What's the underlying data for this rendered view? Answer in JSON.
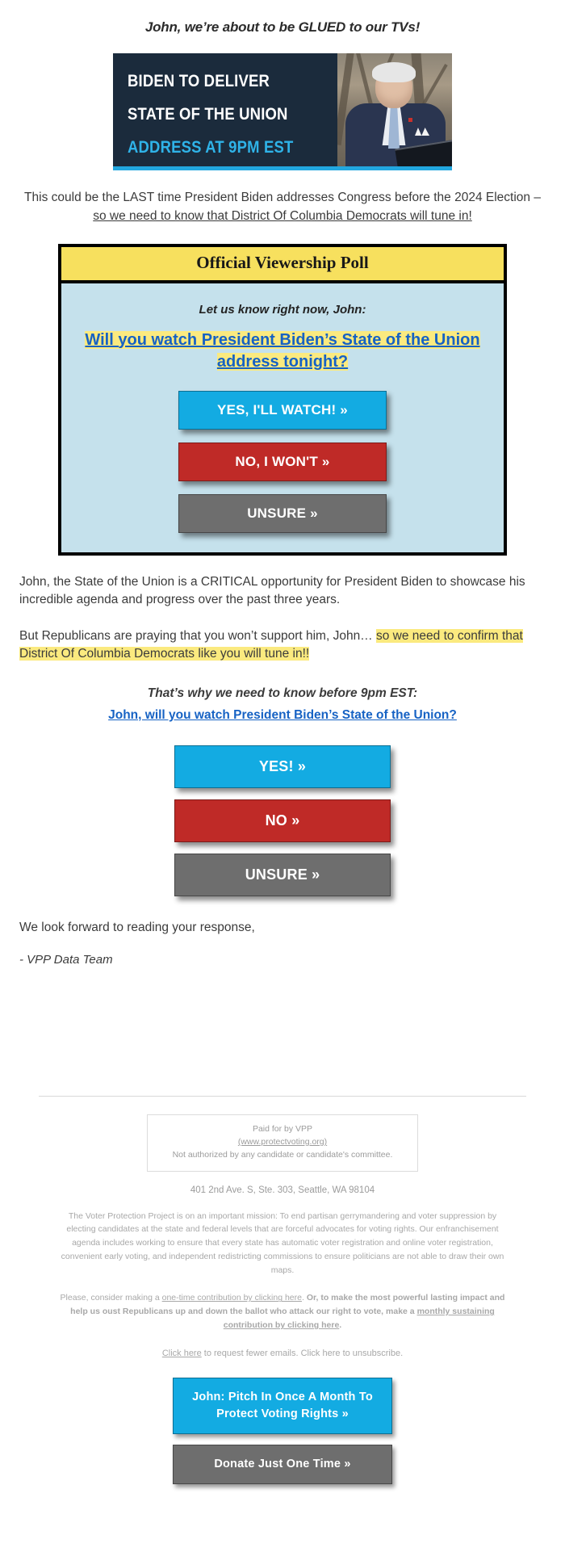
{
  "preheader": "John, we’re about to be GLUED to our TVs!",
  "hero": {
    "line1": "BIDEN TO DELIVER",
    "line2": "STATE OF THE UNION",
    "line3": "ADDRESS AT 9PM EST",
    "photo_alt": "president-biden-photo",
    "bg_color": "#1b2b3c",
    "accent_color": "#2fb3e8"
  },
  "intro": {
    "plain": "This could be the LAST time President Biden addresses Congress before the 2024 Election – ",
    "underlined": "so we need to know that District Of Columbia Democrats will tune in!"
  },
  "poll": {
    "header": "Official Viewership Poll",
    "kicker": "Let us know right now, John:",
    "question": "Will you watch President Biden’s State of the Union address tonight?",
    "header_bg": "#f7e05e",
    "body_bg": "#c5e1ec",
    "buttons": [
      {
        "label": "YES, I'LL WATCH! »",
        "color": "#13abe2",
        "style": "blue"
      },
      {
        "label": "NO, I WON'T »",
        "color": "#bf2a27",
        "style": "red"
      },
      {
        "label": "UNSURE »",
        "color": "#6e6e6e",
        "style": "grey"
      }
    ]
  },
  "body": {
    "p1": "John, the State of the Union is a CRITICAL opportunity for President Biden to showcase his incredible agenda and progress over the past three years.",
    "p2_plain": "But Republicans are praying that you won’t support him, John… ",
    "p2_highlight": "so we need to confirm that District Of Columbia Democrats like you will tune in!!",
    "cta_kicker": "That’s why we need to know before 9pm EST:",
    "cta_question": "John, will you watch President Biden’s State of the Union?",
    "closing": "We look forward to reading your response,",
    "signature": "- VPP Data Team"
  },
  "cta_buttons": [
    {
      "label": "YES! »",
      "color": "#13abe2",
      "style": "blue"
    },
    {
      "label": "NO »",
      "color": "#bf2a27",
      "style": "red"
    },
    {
      "label": "UNSURE »",
      "color": "#6e6e6e",
      "style": "grey"
    }
  ],
  "footer": {
    "paid_for": "Paid for by VPP",
    "website": "(www.protectvoting.org)",
    "not_authorized": "Not authorized by any candidate or candidate's committee.",
    "address": "401 2nd Ave. S, Ste. 303, Seattle, WA 98104",
    "mission": "The Voter Protection Project is on an important mission: To end partisan gerrymandering and voter suppression by electing candidates at the state and federal levels that are forceful advocates for voting rights. Our enfranchisement agenda includes working to ensure that every state has automatic voter registration and online voter registration, convenient early voting, and independent redistricting commissions to ensure politicians are not able to draw their own maps.",
    "ask_intro": "Please, consider making a ",
    "ask_link1": "one-time contribution by clicking here",
    "ask_mid": ". ",
    "ask_bold": "Or, to make the most powerful lasting impact and help us oust Republicans up and down the ballot who attack our right to vote, make a ",
    "ask_link2": "monthly sustaining contribution by clicking here",
    "ask_end": ".",
    "unsub_link": "Click here",
    "unsub_text": " to request fewer emails. Click here to unsubscribe.",
    "buttons": [
      {
        "label": "John: Pitch In Once A Month To Protect Voting Rights »",
        "color": "#13abe2",
        "style": "blue"
      },
      {
        "label": "Donate Just One Time »",
        "color": "#6e6e6e",
        "style": "grey"
      }
    ]
  }
}
